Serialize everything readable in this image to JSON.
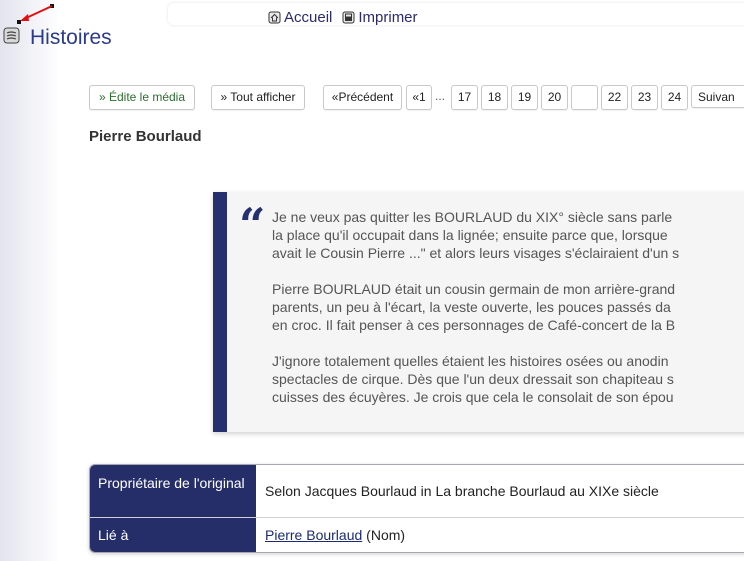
{
  "nav": {
    "home_label": "Accueil",
    "print_label": "Imprimer"
  },
  "section": {
    "title": "Histoires"
  },
  "pager": {
    "edit_label": "» Édite le média",
    "show_all_label": "» Tout afficher",
    "prev_label": "«Précédent",
    "first_label": "«1",
    "ellipsis": "...",
    "pages": [
      "17",
      "18",
      "19",
      "20",
      "",
      "22",
      "23",
      "24"
    ],
    "next_label": "Suivan"
  },
  "media": {
    "title": "Pierre Bourlaud"
  },
  "quote": {
    "mark": "“",
    "paragraphs": [
      [
        "Je ne veux pas quitter les BOURLAUD du XIX° siècle sans parle",
        "la place qu'il occupait dans la lignée; ensuite parce que, lorsque",
        "avait le Cousin Pierre ...\" et alors leurs visages s'éclairaient d'un s"
      ],
      [
        "Pierre BOURLAUD était un cousin germain de mon arrière-grand",
        "parents, un peu à l'écart, la veste ouverte, les pouces passés da",
        "en croc. Il fait penser à ces personnages de Café-concert de la B"
      ],
      [
        "J'ignore totalement quelles étaient les histoires osées ou anodin",
        "spectacles de cirque. Dès que l'un deux dressait son chapiteau s",
        "cuisses des écuyères. Je crois que cela le consolait de son épou"
      ]
    ]
  },
  "info": {
    "owner_label": "Propriétaire de l'original",
    "owner_value": "Selon Jacques Bourlaud in La branche Bourlaud au XIXe siècle",
    "linked_label": "Lié à",
    "linked_link": "Pierre Bourlaud",
    "linked_suffix": " (Nom)"
  },
  "colors": {
    "accent": "#26306e",
    "title": "#2b3b8c",
    "edit_green": "#2c6e2c"
  }
}
